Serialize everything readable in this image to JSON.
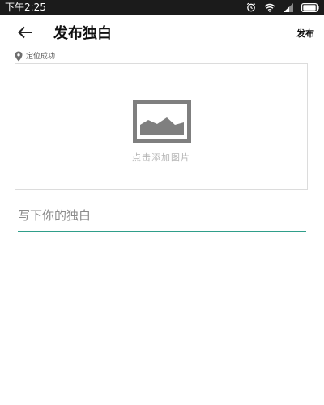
{
  "status_bar": {
    "time": "下午2:25",
    "icons": [
      "alarm-icon",
      "wifi-icon",
      "signal-icon",
      "battery-icon"
    ]
  },
  "app_bar": {
    "back_icon": "arrow-left-icon",
    "title": "发布独白",
    "publish_label": "发布"
  },
  "location": {
    "icon": "location-pin-icon",
    "text": "定位成功"
  },
  "image_picker": {
    "icon": "image-icon",
    "label": "点击添加图片"
  },
  "monologue_input": {
    "value": "",
    "placeholder": "写下你的独白"
  },
  "colors": {
    "status_bar": "#1b1b1b",
    "accent": "#2f9e8a",
    "placeholder": "#8a8a8a",
    "picker_border": "#dcdcdc",
    "image_icon": "#7f7f7f"
  }
}
